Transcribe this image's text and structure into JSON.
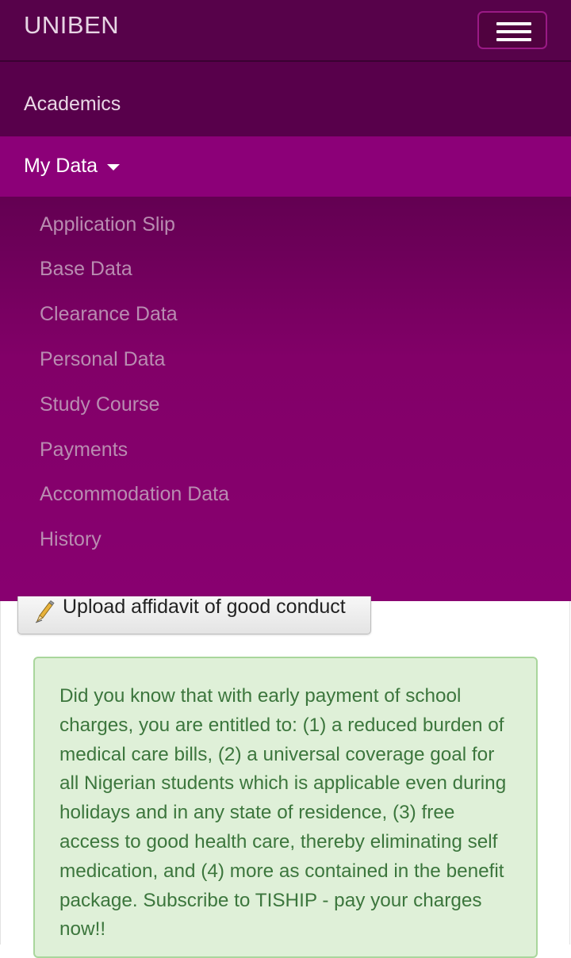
{
  "brand": "UNIBEN",
  "nav": {
    "academics": "Academics",
    "my_data": "My Data"
  },
  "dropdown": [
    "Application Slip",
    "Base Data",
    "Clearance Data",
    "Personal Data",
    "Study Course",
    "Payments",
    "Accommodation Data",
    "History"
  ],
  "upload_button": "Upload affidavit of good conduct",
  "alert_text": "Did you know that with early payment of school charges, you are entitled to: (1) a reduced burden of medical care bills, (2) a universal coverage goal for all Nigerian students which is applicable even during holidays and in any state of residence, (3) free access to good health care, thereby eliminating self medication, and (4) more as contained in the benefit package. Subscribe to TISHIP - pay your charges now!!",
  "icons": {
    "menu": "hamburger-menu-icon",
    "dropdown": "caret-down-icon",
    "upload": "pen-icon"
  },
  "colors": {
    "navbar": "#57024a",
    "menu_active": "#8c0078",
    "dropdown_bg": "#800066",
    "dropdown_text": "#b98cb1",
    "alert_bg": "#dff0d8",
    "alert_text": "#3c763d"
  }
}
